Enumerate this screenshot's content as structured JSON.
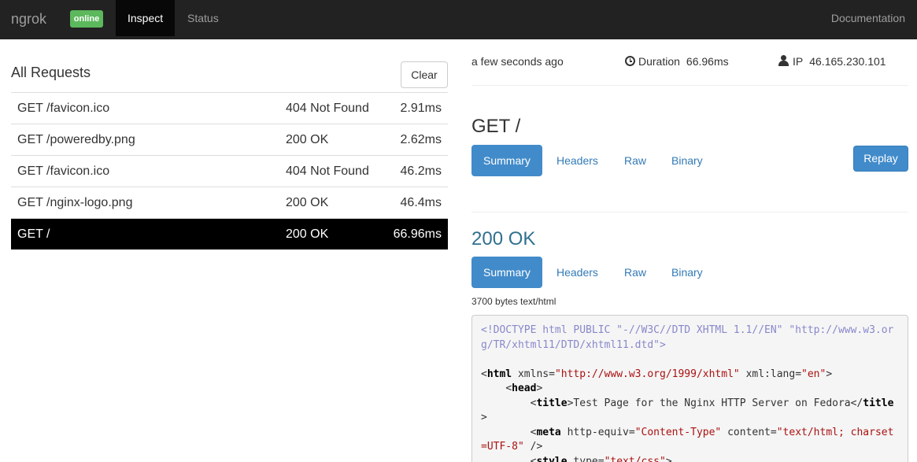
{
  "navbar": {
    "brand": "ngrok",
    "badge": "online",
    "tabs": [
      {
        "label": "Inspect",
        "active": true
      },
      {
        "label": "Status",
        "active": false
      }
    ],
    "docs": "Documentation"
  },
  "requests": {
    "title": "All Requests",
    "clear_label": "Clear",
    "rows": [
      {
        "path": "GET /favicon.ico",
        "status": "404 Not Found",
        "duration": "2.91ms",
        "selected": false
      },
      {
        "path": "GET /poweredby.png",
        "status": "200 OK",
        "duration": "2.62ms",
        "selected": false
      },
      {
        "path": "GET /favicon.ico",
        "status": "404 Not Found",
        "duration": "46.2ms",
        "selected": false
      },
      {
        "path": "GET /nginx-logo.png",
        "status": "200 OK",
        "duration": "46.4ms",
        "selected": false
      },
      {
        "path": "GET /",
        "status": "200 OK",
        "duration": "66.96ms",
        "selected": true
      }
    ]
  },
  "detail": {
    "time": "a few seconds ago",
    "duration_label": "Duration",
    "duration_value": "66.96ms",
    "ip_label": "IP",
    "ip_value": "46.165.230.101",
    "request_heading": "GET /",
    "request_tabs": [
      "Summary",
      "Headers",
      "Raw",
      "Binary"
    ],
    "replay_label": "Replay",
    "response_heading": "200 OK",
    "response_tabs": [
      "Summary",
      "Headers",
      "Raw",
      "Binary"
    ],
    "body_info": "3700 bytes text/html",
    "code": {
      "doctype": "<!DOCTYPE html PUBLIC \"-//W3C//DTD XHTML 1.1//EN\" \"http://www.w3.org/TR/xhtml11/DTD/xhtml11.dtd\">",
      "html_open": "html",
      "html_xmlns_attr": "xmlns=",
      "html_xmlns_val": "\"http://www.w3.org/1999/xhtml\"",
      "html_lang_attr": "xml:lang=",
      "html_lang_val": "\"en\"",
      "head": "head",
      "title_tag": "title",
      "title_text": "Test Page for the Nginx HTTP Server on Fedora",
      "meta_tag": "meta",
      "meta_equiv_attr": "http-equiv=",
      "meta_equiv_val": "\"Content-Type\"",
      "meta_content_attr": "content=",
      "meta_content_val": "\"text/html; charset=UTF-8\"",
      "style_tag": "style",
      "style_type_attr": "type=",
      "style_type_val": "\"text/css\""
    }
  },
  "colors": {
    "navbar_bg": "#222222",
    "badge_green": "#5cb85c",
    "primary_blue": "#428bca",
    "link_blue": "#337ab7",
    "response_heading": "#31708f",
    "selected_row": "#000000"
  }
}
